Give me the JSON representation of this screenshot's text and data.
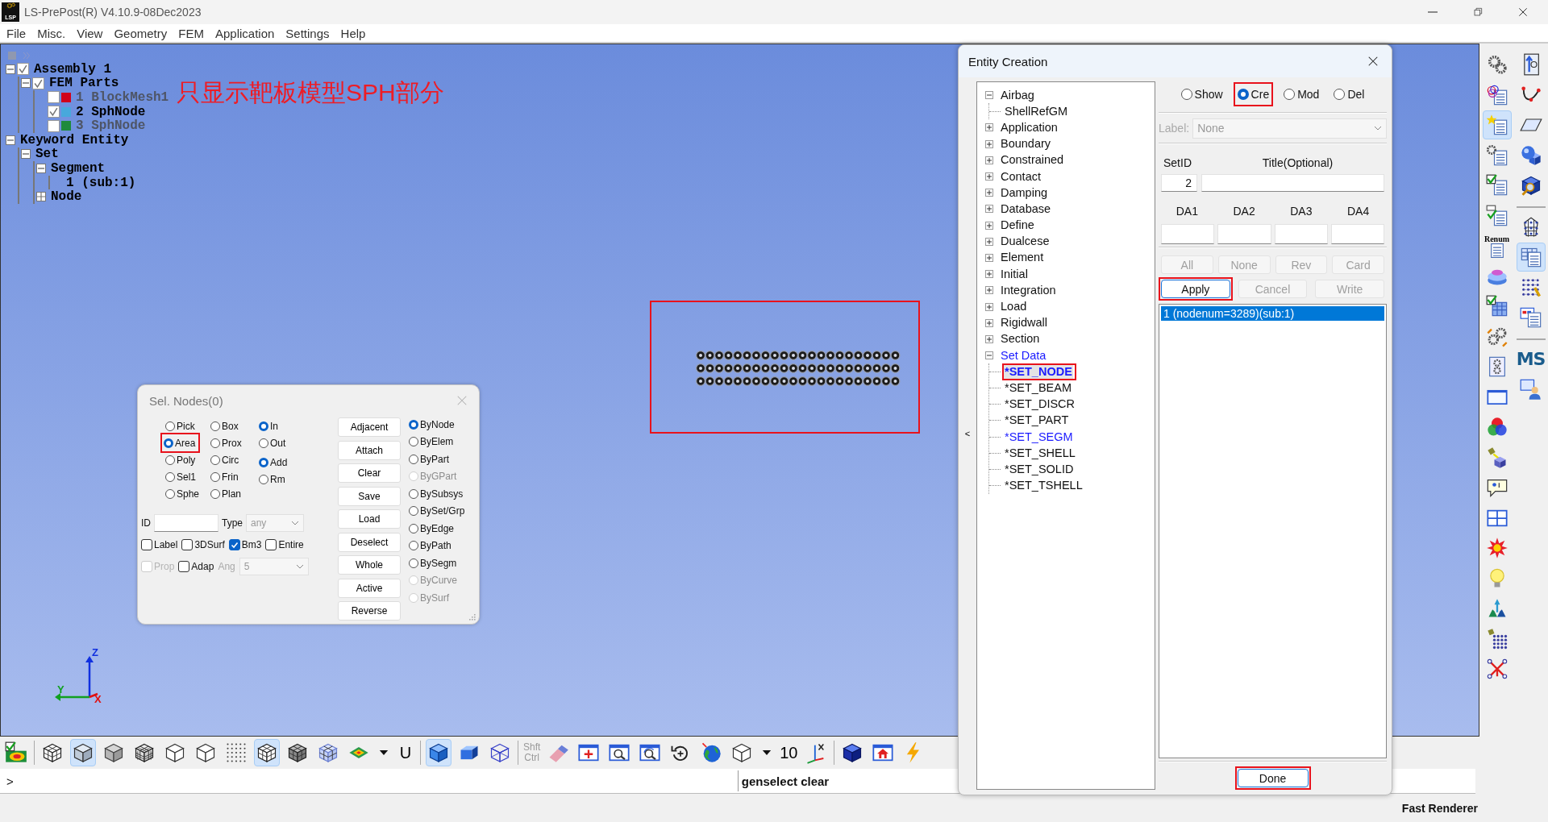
{
  "window": {
    "logo_text": "LSP",
    "title": "LS-PrePost(R) V4.10.9-08Dec2023"
  },
  "menu": [
    "File",
    "Misc.",
    "View",
    "Geometry",
    "FEM",
    "Application",
    "Settings",
    "Help"
  ],
  "model_tree": [
    {
      "label": "Assembly 1",
      "expanded": true,
      "checked": true,
      "children": [
        {
          "label": "FEM Parts",
          "expanded": true,
          "checked": true,
          "children": [
            {
              "label": "1 BlockMesh1",
              "checked": false,
              "color": "#d0021b"
            },
            {
              "label": "2 SphNode",
              "checked": true,
              "color": "#48a8dc"
            },
            {
              "label": "3 SphNode",
              "checked": false,
              "color": "#1f8a3c"
            }
          ]
        }
      ]
    },
    {
      "label": "Keyword Entity",
      "expanded": true,
      "children": [
        {
          "label": "Set",
          "expanded": true,
          "children": [
            {
              "label": "Segment",
              "expanded": true,
              "children": [
                {
                  "label": "1 (sub:1)"
                }
              ]
            },
            {
              "label": "Node",
              "expanded": false
            }
          ]
        }
      ]
    }
  ],
  "annotation": "只显示靶板模型SPH部分",
  "target_mesh": {
    "highlighted": true
  },
  "axes": {
    "z": "Z",
    "y": "Y",
    "x": "X"
  },
  "sel_nodes": {
    "title": "Sel. Nodes(0)",
    "methods": [
      {
        "label": "Pick",
        "selected": false
      },
      {
        "label": "Box",
        "selected": false
      },
      {
        "label": "Area",
        "selected": true,
        "highlighted": true
      },
      {
        "label": "Prox",
        "selected": false
      },
      {
        "label": "Poly",
        "selected": false
      },
      {
        "label": "Circ",
        "selected": false
      },
      {
        "label": "Sel1",
        "selected": false
      },
      {
        "label": "Frin",
        "selected": false
      },
      {
        "label": "Sphe",
        "selected": false
      },
      {
        "label": "Plan",
        "selected": false
      }
    ],
    "region": [
      {
        "label": "In",
        "selected": true
      },
      {
        "label": "Out",
        "selected": false
      }
    ],
    "mode": [
      {
        "label": "Add",
        "selected": true
      },
      {
        "label": "Rm",
        "selected": false
      }
    ],
    "id_label": "ID",
    "type_label": "Type",
    "type_value": "any",
    "type_disabled": true,
    "options": [
      {
        "label": "Label",
        "checked": false,
        "disabled": false
      },
      {
        "label": "3DSurf",
        "checked": false,
        "disabled": false
      },
      {
        "label": "Bm3",
        "checked": true,
        "disabled": false
      },
      {
        "label": "Entire",
        "checked": false,
        "disabled": false
      },
      {
        "label": "Prop",
        "checked": false,
        "disabled": true
      },
      {
        "label": "Adap",
        "checked": false,
        "disabled": false
      }
    ],
    "angle_label": "Ang",
    "angle_value": "5",
    "angle_disabled": true,
    "actions": [
      "Adjacent",
      "Attach",
      "Clear",
      "Save",
      "Load",
      "Deselect",
      "Whole",
      "Active",
      "Reverse"
    ],
    "by": [
      {
        "label": "ByNode",
        "selected": true,
        "disabled": false
      },
      {
        "label": "ByElem",
        "selected": false,
        "disabled": false
      },
      {
        "label": "ByPart",
        "selected": false,
        "disabled": false
      },
      {
        "label": "ByGPart",
        "selected": false,
        "disabled": true
      },
      {
        "label": "BySubsys",
        "selected": false,
        "disabled": false
      },
      {
        "label": "BySet/Grp",
        "selected": false,
        "disabled": false
      },
      {
        "label": "ByEdge",
        "selected": false,
        "disabled": false
      },
      {
        "label": "ByPath",
        "selected": false,
        "disabled": false
      },
      {
        "label": "BySegm",
        "selected": false,
        "disabled": false
      },
      {
        "label": "ByCurve",
        "selected": false,
        "disabled": true
      },
      {
        "label": "BySurf",
        "selected": false,
        "disabled": true
      }
    ]
  },
  "entity_creation": {
    "title": "Entity Creation",
    "collapse_handle": "<",
    "tree": [
      {
        "label": "Airbag",
        "expanded": true,
        "selected": false,
        "has_data": false,
        "children": [
          {
            "label": "ShellRefGM",
            "selected": false,
            "has_data": false
          }
        ]
      },
      {
        "label": "Application",
        "expanded": false,
        "selected": false,
        "has_data": false
      },
      {
        "label": "Boundary",
        "expanded": false,
        "selected": false,
        "has_data": false
      },
      {
        "label": "Constrained",
        "expanded": false,
        "selected": false,
        "has_data": false
      },
      {
        "label": "Contact",
        "expanded": false,
        "selected": false,
        "has_data": false
      },
      {
        "label": "Damping",
        "expanded": false,
        "selected": false,
        "has_data": false
      },
      {
        "label": "Database",
        "expanded": false,
        "selected": false,
        "has_data": false
      },
      {
        "label": "Define",
        "expanded": false,
        "selected": false,
        "has_data": false
      },
      {
        "label": "Dualcese",
        "expanded": false,
        "selected": false,
        "has_data": false
      },
      {
        "label": "Element",
        "expanded": false,
        "selected": false,
        "has_data": false
      },
      {
        "label": "Initial",
        "expanded": false,
        "selected": false,
        "has_data": false
      },
      {
        "label": "Integration",
        "expanded": false,
        "selected": false,
        "has_data": false
      },
      {
        "label": "Load",
        "expanded": false,
        "selected": false,
        "has_data": false
      },
      {
        "label": "Rigidwall",
        "expanded": false,
        "selected": false,
        "has_data": false
      },
      {
        "label": "Section",
        "expanded": false,
        "selected": false,
        "has_data": false
      },
      {
        "label": "Set Data",
        "expanded": true,
        "selected": false,
        "has_data": true,
        "children": [
          {
            "label": "*SET_NODE",
            "selected": true,
            "has_data": true,
            "highlighted": true
          },
          {
            "label": "*SET_BEAM",
            "selected": false,
            "has_data": false
          },
          {
            "label": "*SET_DISCR",
            "selected": false,
            "has_data": false
          },
          {
            "label": "*SET_PART",
            "selected": false,
            "has_data": false
          },
          {
            "label": "*SET_SEGM",
            "selected": false,
            "has_data": true
          },
          {
            "label": "*SET_SHELL",
            "selected": false,
            "has_data": false
          },
          {
            "label": "*SET_SOLID",
            "selected": false,
            "has_data": false
          },
          {
            "label": "*SET_TSHELL",
            "selected": false,
            "has_data": false
          }
        ]
      }
    ],
    "modes": [
      {
        "label": "Show",
        "selected": false
      },
      {
        "label": "Cre",
        "selected": true,
        "highlighted": true
      },
      {
        "label": "Mod",
        "selected": false
      },
      {
        "label": "Del",
        "selected": false
      }
    ],
    "label_field": {
      "label": "Label:",
      "value": "None",
      "disabled": true
    },
    "setid_header": "SetID",
    "title_header": "Title(Optional)",
    "setid": "2",
    "da_headers": [
      "DA1",
      "DA2",
      "DA3",
      "DA4"
    ],
    "buttons_row1": [
      {
        "label": "All",
        "disabled": true
      },
      {
        "label": "None",
        "disabled": true
      },
      {
        "label": "Rev",
        "disabled": true
      },
      {
        "label": "Card",
        "disabled": true
      }
    ],
    "buttons_row2": [
      {
        "label": "Apply",
        "disabled": false,
        "highlighted": true
      },
      {
        "label": "Cancel",
        "disabled": true
      },
      {
        "label": "Write",
        "disabled": true
      }
    ],
    "list": [
      {
        "text": "1 (nodenum=3289)(sub:1)",
        "selected": true
      }
    ],
    "done": {
      "label": "Done",
      "highlighted": true
    }
  },
  "bottom_toolbar": [
    {
      "kind": "button",
      "selected": false
    },
    {
      "kind": "separator"
    },
    {
      "kind": "button",
      "selected": false
    },
    {
      "kind": "button",
      "selected": true
    },
    {
      "kind": "button",
      "selected": false
    },
    {
      "kind": "button",
      "selected": false
    },
    {
      "kind": "button",
      "selected": false
    },
    {
      "kind": "button",
      "selected": false
    },
    {
      "kind": "button",
      "selected": false
    },
    {
      "kind": "button",
      "selected": true
    },
    {
      "kind": "button",
      "selected": false
    },
    {
      "kind": "button",
      "selected": false
    },
    {
      "kind": "button",
      "selected": false
    },
    {
      "kind": "button",
      "selected": false
    },
    {
      "kind": "text",
      "text": "U"
    },
    {
      "kind": "separator"
    },
    {
      "kind": "button",
      "selected": true
    },
    {
      "kind": "button",
      "selected": false
    },
    {
      "kind": "button",
      "selected": false
    },
    {
      "kind": "separator"
    },
    {
      "kind": "shortcut",
      "lines": [
        "Shft",
        "Ctrl"
      ]
    },
    {
      "kind": "button",
      "selected": false
    },
    {
      "kind": "button",
      "selected": false
    },
    {
      "kind": "button",
      "selected": false
    },
    {
      "kind": "button",
      "selected": false
    },
    {
      "kind": "button",
      "selected": false
    },
    {
      "kind": "button",
      "selected": false
    },
    {
      "kind": "button",
      "selected": false
    },
    {
      "kind": "button",
      "selected": false
    },
    {
      "kind": "text",
      "text": "10"
    },
    {
      "kind": "button",
      "selected": false
    },
    {
      "kind": "separator"
    },
    {
      "kind": "button",
      "selected": false
    },
    {
      "kind": "button",
      "selected": false
    },
    {
      "kind": "button",
      "selected": false
    }
  ],
  "right_toolbar": {
    "left": [
      {
        "kind": "button",
        "selected": false
      },
      {
        "kind": "button",
        "selected": false
      },
      {
        "kind": "button",
        "selected": true
      },
      {
        "kind": "button",
        "selected": false
      },
      {
        "kind": "button",
        "selected": false
      },
      {
        "kind": "button",
        "selected": false
      },
      {
        "kind": "button",
        "selected": false,
        "caption": "Renum"
      },
      {
        "kind": "button",
        "selected": false
      },
      {
        "kind": "button",
        "selected": false
      },
      {
        "kind": "button",
        "selected": false
      },
      {
        "kind": "button",
        "selected": false
      },
      {
        "kind": "button",
        "selected": false
      },
      {
        "kind": "button",
        "selected": false
      },
      {
        "kind": "button",
        "selected": false
      },
      {
        "kind": "button",
        "selected": false
      },
      {
        "kind": "button",
        "selected": false
      },
      {
        "kind": "button",
        "selected": false
      },
      {
        "kind": "button",
        "selected": false
      },
      {
        "kind": "button",
        "selected": false
      },
      {
        "kind": "button",
        "selected": false
      },
      {
        "kind": "button",
        "selected": false
      }
    ],
    "right": [
      {
        "kind": "button",
        "selected": false
      },
      {
        "kind": "button",
        "selected": false
      },
      {
        "kind": "button",
        "selected": false
      },
      {
        "kind": "button",
        "selected": false
      },
      {
        "kind": "button",
        "selected": false
      },
      {
        "kind": "separator"
      },
      {
        "kind": "button",
        "selected": false
      },
      {
        "kind": "button",
        "selected": true
      },
      {
        "kind": "button",
        "selected": false
      },
      {
        "kind": "button",
        "selected": false
      },
      {
        "kind": "separator"
      },
      {
        "kind": "text",
        "text": "MS"
      },
      {
        "kind": "button",
        "selected": false
      }
    ]
  },
  "command_line": {
    "prompt": ">",
    "message": "genselect clear"
  },
  "status_bar": {
    "renderer": "Fast Renderer"
  }
}
